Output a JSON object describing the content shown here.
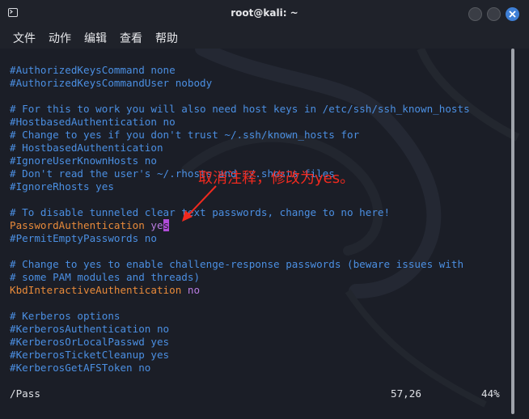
{
  "window": {
    "title": "root@kali: ~",
    "accent": "#3e7fd6"
  },
  "menu": {
    "items": [
      "文件",
      "动作",
      "编辑",
      "查看",
      "帮助"
    ]
  },
  "editor": {
    "lines": [
      "#AuthorizedKeysCommand none",
      "#AuthorizedKeysCommandUser nobody",
      "",
      "# For this to work you will also need host keys in /etc/ssh/ssh_known_hosts",
      "#HostbasedAuthentication no",
      "# Change to yes if you don't trust ~/.ssh/known_hosts for",
      "# HostbasedAuthentication",
      "#IgnoreUserKnownHosts no",
      "# Don't read the user's ~/.rhosts and ~/.shosts files",
      "#IgnoreRhosts yes",
      "",
      "# To disable tunneled clear text passwords, change to no here!"
    ],
    "password_auth": {
      "key": "PasswordAuthentication",
      "value_before_cursor": "ye",
      "cursor_char": "s"
    },
    "lines_after_password": [
      "#PermitEmptyPasswords no",
      "",
      "# Change to yes to enable challenge-response passwords (beware issues with",
      "# some PAM modules and threads)"
    ],
    "kbd_auth": {
      "key": "KbdInteractiveAuthentication",
      "value": "no"
    },
    "lines_tail": [
      "",
      "# Kerberos options",
      "#KerberosAuthentication no",
      "#KerberosOrLocalPasswd yes",
      "#KerberosTicketCleanup yes",
      "#KerberosGetAFSToken no"
    ]
  },
  "status": {
    "command": "/Pass",
    "position": "57,26",
    "percent": "44%"
  },
  "annotation": {
    "text": "取消注释，修改为yes。",
    "color": "#f02a1f"
  },
  "colors": {
    "comment": "#4b8fe2",
    "keyword": "#e88a3a",
    "value": "#b87ce0",
    "cursor": "#b04cd8"
  }
}
